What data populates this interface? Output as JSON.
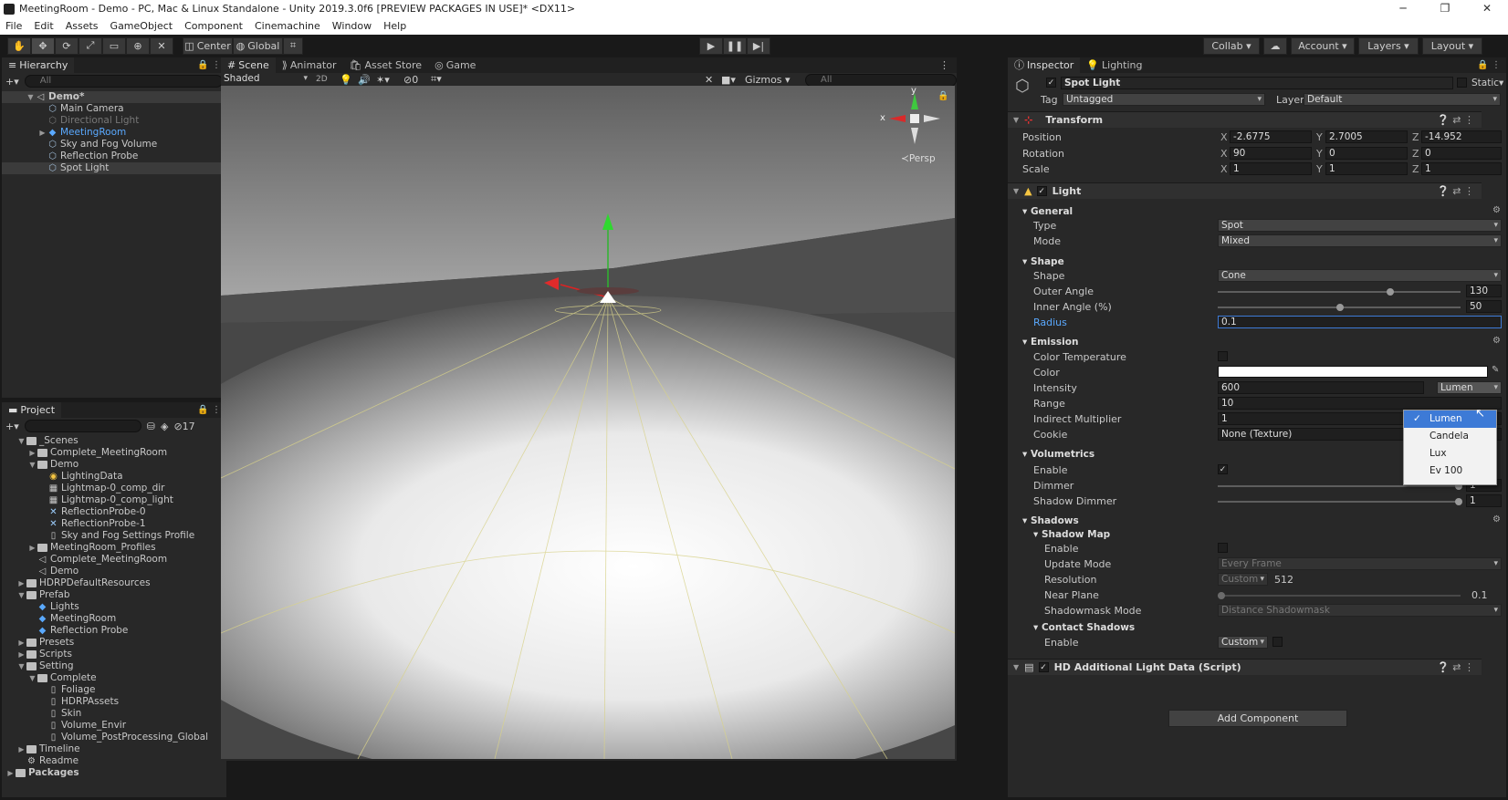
{
  "window": {
    "title": "MeetingRoom - Demo - PC, Mac & Linux Standalone - Unity 2019.3.0f6 [PREVIEW PACKAGES IN USE]* <DX11>"
  },
  "menu": [
    "File",
    "Edit",
    "Assets",
    "GameObject",
    "Component",
    "Cinemachine",
    "Window",
    "Help"
  ],
  "toolbar": {
    "center": "Center",
    "global": "Global",
    "collab": "Collab",
    "account": "Account",
    "layers": "Layers",
    "layout": "Layout"
  },
  "hierarchy": {
    "tab": "Hierarchy",
    "search_placeholder": "All",
    "scene": "Demo*",
    "items": [
      "Main Camera",
      "Directional Light",
      "MeetingRoom",
      "Sky and Fog Volume",
      "Reflection Probe",
      "Spot Light"
    ]
  },
  "project": {
    "tab": "Project",
    "hidden_count": "17",
    "items": [
      {
        "label": "_Scenes",
        "depth": 0,
        "open": true,
        "type": "folder"
      },
      {
        "label": "Complete_MeetingRoom",
        "depth": 1,
        "open": false,
        "type": "folder"
      },
      {
        "label": "Demo",
        "depth": 1,
        "open": true,
        "type": "folder"
      },
      {
        "label": "LightingData",
        "depth": 2,
        "type": "asset"
      },
      {
        "label": "Lightmap-0_comp_dir",
        "depth": 2,
        "type": "texture"
      },
      {
        "label": "Lightmap-0_comp_light",
        "depth": 2,
        "type": "texture"
      },
      {
        "label": "ReflectionProbe-0",
        "depth": 2,
        "type": "probe"
      },
      {
        "label": "ReflectionProbe-1",
        "depth": 2,
        "type": "probe"
      },
      {
        "label": "Sky and Fog Settings Profile",
        "depth": 2,
        "type": "file"
      },
      {
        "label": "MeetingRoom_Profiles",
        "depth": 1,
        "open": false,
        "type": "folder"
      },
      {
        "label": "Complete_MeetingRoom",
        "depth": 1,
        "type": "scene"
      },
      {
        "label": "Demo",
        "depth": 1,
        "type": "scene"
      },
      {
        "label": "HDRPDefaultResources",
        "depth": 0,
        "open": false,
        "type": "folder"
      },
      {
        "label": "Prefab",
        "depth": 0,
        "open": true,
        "type": "folder"
      },
      {
        "label": "Lights",
        "depth": 1,
        "type": "prefab"
      },
      {
        "label": "MeetingRoom",
        "depth": 1,
        "type": "prefab"
      },
      {
        "label": "Reflection Probe",
        "depth": 1,
        "type": "prefab"
      },
      {
        "label": "Presets",
        "depth": 0,
        "open": false,
        "type": "folder"
      },
      {
        "label": "Scripts",
        "depth": 0,
        "open": false,
        "type": "folder"
      },
      {
        "label": "Setting",
        "depth": 0,
        "open": true,
        "type": "folder"
      },
      {
        "label": "Complete",
        "depth": 1,
        "open": true,
        "type": "folder"
      },
      {
        "label": "Foliage",
        "depth": 2,
        "type": "file"
      },
      {
        "label": "HDRPAssets",
        "depth": 2,
        "type": "file"
      },
      {
        "label": "Skin",
        "depth": 2,
        "type": "file"
      },
      {
        "label": "Volume_Envir",
        "depth": 2,
        "type": "file"
      },
      {
        "label": "Volume_PostProcessing_Global",
        "depth": 2,
        "type": "file"
      },
      {
        "label": "Timeline",
        "depth": 0,
        "open": false,
        "type": "folder"
      },
      {
        "label": "Readme",
        "depth": 0,
        "type": "readme"
      },
      {
        "label": "Packages",
        "depth": -1,
        "open": false,
        "type": "folder"
      }
    ]
  },
  "scene": {
    "tabs": [
      "Scene",
      "Animator",
      "Asset Store",
      "Game"
    ],
    "shading": "Shaded",
    "mode_2d": "2D",
    "hidden": "0",
    "gizmos": "Gizmos",
    "search": "All",
    "persp": "Persp",
    "axis_x": "x",
    "axis_y": "y"
  },
  "inspector": {
    "tabs": [
      "Inspector",
      "Lighting"
    ],
    "object_name": "Spot Light",
    "static": "Static",
    "tag_label": "Tag",
    "tag": "Untagged",
    "layer_label": "Layer",
    "layer": "Default",
    "transform": {
      "title": "Transform",
      "position": {
        "label": "Position",
        "x": "-2.6775",
        "y": "2.7005",
        "z": "-14.952"
      },
      "rotation": {
        "label": "Rotation",
        "x": "90",
        "y": "0",
        "z": "0"
      },
      "scale": {
        "label": "Scale",
        "x": "1",
        "y": "1",
        "z": "1"
      }
    },
    "light": {
      "title": "Light",
      "general": "General",
      "type_label": "Type",
      "type": "Spot",
      "mode_label": "Mode",
      "mode": "Mixed",
      "shape_section": "Shape",
      "shape_label": "Shape",
      "shape": "Cone",
      "outer_label": "Outer Angle",
      "outer": "130",
      "outer_frac": 0.71,
      "inner_label": "Inner Angle (%)",
      "inner": "50",
      "inner_frac": 0.5,
      "radius_label": "Radius",
      "radius": "0.1",
      "emission": "Emission",
      "color_temp_label": "Color Temperature",
      "color_label": "Color",
      "intensity_label": "Intensity",
      "intensity": "600",
      "unit": "Lumen",
      "range_label": "Range",
      "range": "10",
      "indirect_label": "Indirect Multiplier",
      "indirect": "1",
      "cookie_label": "Cookie",
      "cookie": "None (Texture)",
      "volumetrics": "Volumetrics",
      "enable_label": "Enable",
      "dimmer_label": "Dimmer",
      "dimmer": "1",
      "dimmer_frac": 1.0,
      "shadow_dimmer_label": "Shadow Dimmer",
      "shadow_dimmer": "1",
      "shadow_dimmer_frac": 1.0,
      "shadows": "Shadows",
      "shadow_map": "Shadow Map",
      "sm_enable": "Enable",
      "update_label": "Update Mode",
      "update": "Every Frame",
      "res_label": "Resolution",
      "res_mode": "Custom",
      "res": "512",
      "near_label": "Near Plane",
      "near": "0.1",
      "near_frac": 0.0,
      "shadowmask_label": "Shadowmask Mode",
      "shadowmask": "Distance Shadowmask",
      "contact": "Contact Shadows",
      "contact_enable": "Enable",
      "contact_mode": "Custom"
    },
    "hd": {
      "title": "HD Additional Light Data (Script)"
    },
    "add_component": "Add Component",
    "unit_options": [
      "Lumen",
      "Candela",
      "Lux",
      "Ev 100"
    ]
  }
}
